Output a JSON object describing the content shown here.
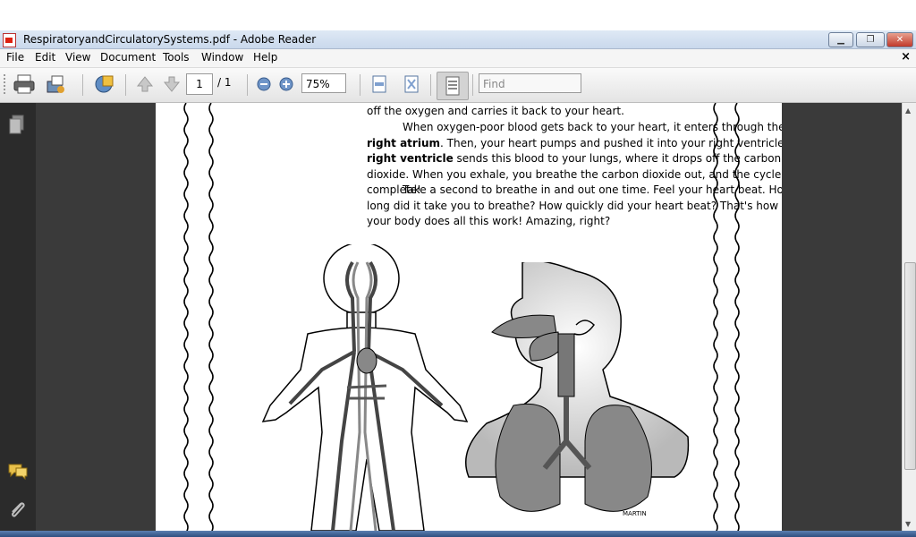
{
  "window": {
    "title": "RespiratoryandCirculatorySystems.pdf - Adobe Reader",
    "controls": [
      "minimize",
      "maximize",
      "close"
    ]
  },
  "menu": {
    "items": [
      "File",
      "Edit",
      "View",
      "Document",
      "Tools",
      "Window",
      "Help"
    ],
    "close_glyph": "×"
  },
  "toolbar": {
    "page_current": "1",
    "page_total": "/ 1",
    "zoom": "75%",
    "find_placeholder": "Find",
    "icons": [
      "print-icon",
      "attach-email-icon",
      "collaborate-icon",
      "previous-page-icon",
      "next-page-icon",
      "zoom-out-icon",
      "zoom-in-icon",
      "fit-width-icon",
      "fit-page-icon",
      "reading-mode-icon"
    ]
  },
  "sidebar": {
    "icons": [
      "pages-icon",
      "comments-icon",
      "attachments-icon"
    ]
  },
  "document": {
    "line_top": "off the oxygen and carries it back to your heart.",
    "p2": {
      "a": "When oxygen-poor blood gets back to your heart, it enters through the ",
      "b1": "right atrium",
      "c": ". Then, your heart pumps and pushed it into your right ventricle. The ",
      "b2": "right ventricle",
      "d": " sends this blood to your lungs, where it drops off the carbon dioxide. When you exhale, you breathe the carbon dioxide out, and the cycle is complete!"
    },
    "p3": "Take a second to breathe in and out one time. Feel your heart beat. How long did it take you to breathe? How quickly did your heart beat? That's how fast your body does all this work! Amazing, right?",
    "credit": "MARTIN"
  },
  "colors": {
    "panel_dark": "#2b2b2b",
    "doc_bg": "#3a3a3a",
    "titlebar": "#c9d8ec"
  }
}
